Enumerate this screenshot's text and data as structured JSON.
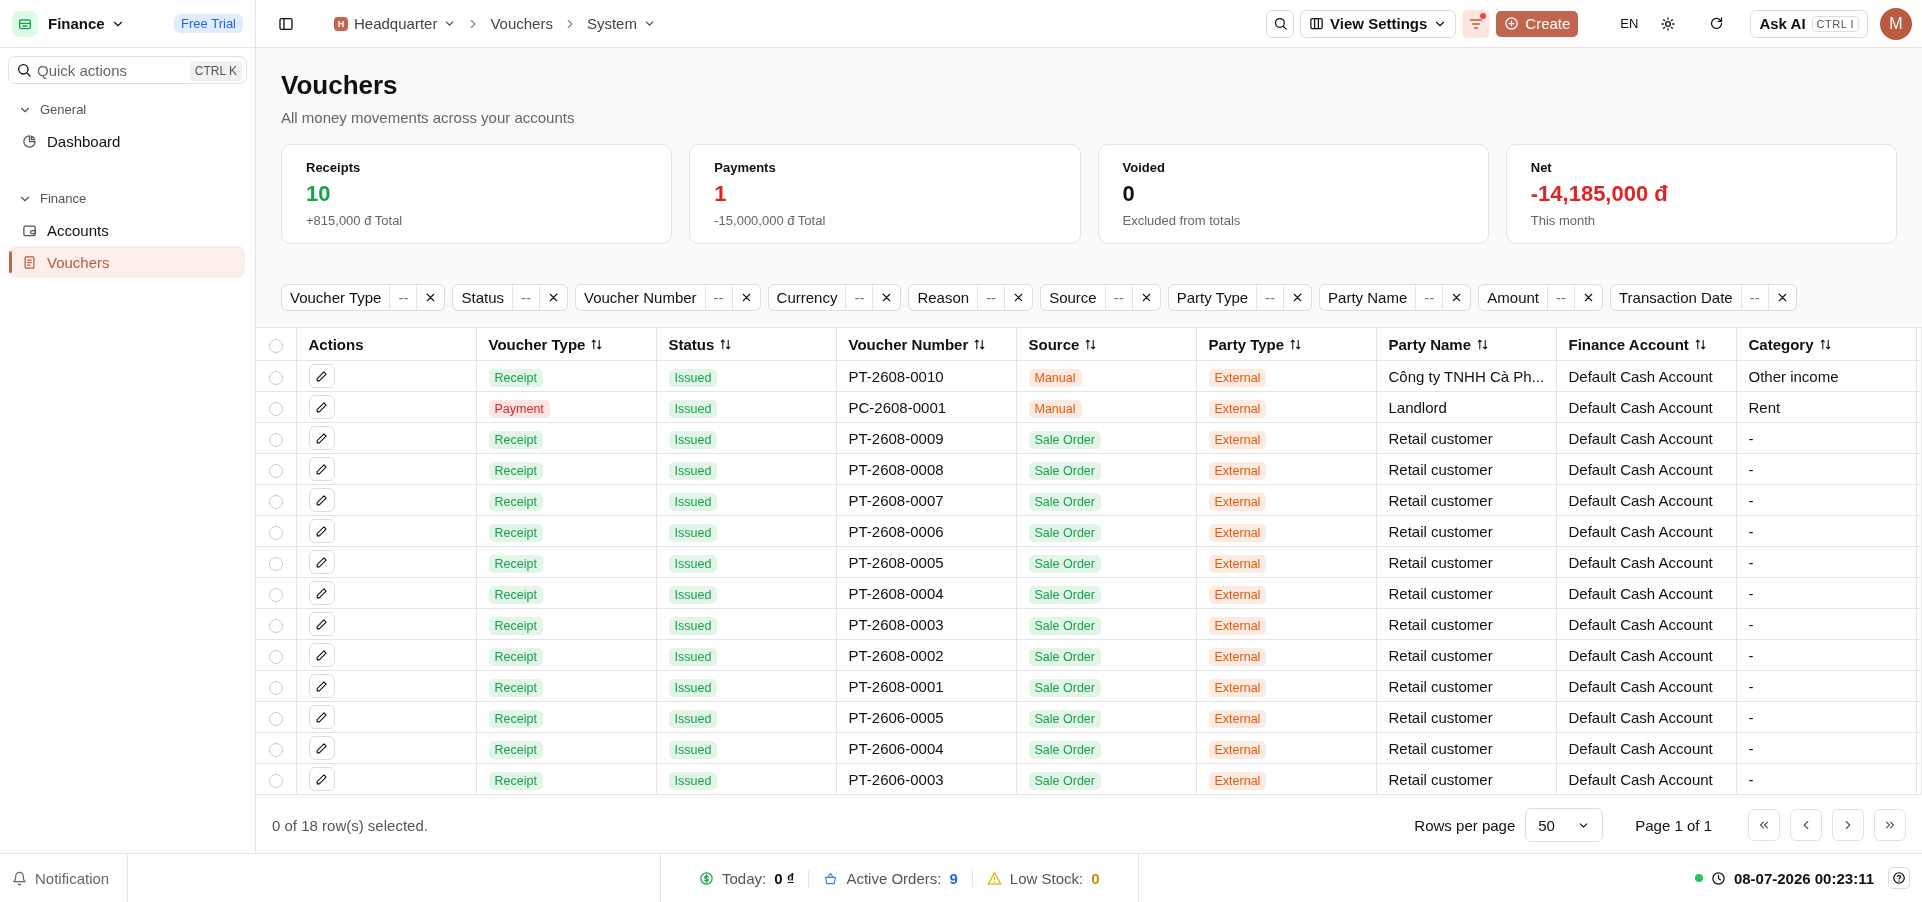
{
  "app": {
    "name": "Finance",
    "badge": "Free Trial"
  },
  "sidebar": {
    "search": {
      "placeholder": "Quick actions",
      "shortcut": "CTRL K"
    },
    "groups": [
      {
        "label": "General",
        "expanded": true,
        "items": [
          {
            "label": "Dashboard",
            "selected": false
          }
        ]
      },
      {
        "label": "Finance",
        "expanded": true,
        "items": [
          {
            "label": "Accounts",
            "selected": false
          },
          {
            "label": "Vouchers",
            "selected": true
          }
        ]
      }
    ]
  },
  "topbar": {
    "breadcrumb": [
      {
        "label": "Headquarter",
        "initial": "H",
        "dropdown": true
      },
      {
        "label": "Vouchers",
        "dropdown": false
      },
      {
        "label": "System",
        "dropdown": true
      }
    ],
    "view_settings": "View Settings",
    "filter_badge": true,
    "create": "Create",
    "language": "EN",
    "ask_ai": "Ask AI",
    "ask_ai_shortcut": "CTRL I",
    "avatar": "M"
  },
  "page": {
    "title": "Vouchers",
    "subtitle": "All money movements across your accounts"
  },
  "stats": [
    {
      "label": "Receipts",
      "value": "10",
      "color": "#16a34a",
      "note": "+815,000 đ Total"
    },
    {
      "label": "Payments",
      "value": "1",
      "color": "#dc2626",
      "note": "-15,000,000 đ Total"
    },
    {
      "label": "Voided",
      "value": "0",
      "color": "#111111",
      "note": "Excluded from totals"
    },
    {
      "label": "Net",
      "value": "-14,185,000 đ",
      "color": "#dc2626",
      "note": "This month"
    }
  ],
  "filters": [
    {
      "label": "Voucher Type",
      "value": "--"
    },
    {
      "label": "Status",
      "value": "--"
    },
    {
      "label": "Voucher Number",
      "value": "--"
    },
    {
      "label": "Currency",
      "value": "--"
    },
    {
      "label": "Reason",
      "value": "--"
    },
    {
      "label": "Source",
      "value": "--"
    },
    {
      "label": "Party Type",
      "value": "--"
    },
    {
      "label": "Party Name",
      "value": "--"
    },
    {
      "label": "Amount",
      "value": "--"
    },
    {
      "label": "Transaction Date",
      "value": "--"
    }
  ],
  "table": {
    "select_all_checked": false,
    "columns": [
      {
        "label": "Actions",
        "sortable": false
      },
      {
        "label": "Voucher Type",
        "sortable": true
      },
      {
        "label": "Status",
        "sortable": true
      },
      {
        "label": "Voucher Number",
        "sortable": true
      },
      {
        "label": "Source",
        "sortable": true
      },
      {
        "label": "Party Type",
        "sortable": true
      },
      {
        "label": "Party Name",
        "sortable": true
      },
      {
        "label": "Finance Account",
        "sortable": true
      },
      {
        "label": "Category",
        "sortable": true
      }
    ],
    "rows": [
      {
        "checked": false,
        "voucher_type": {
          "text": "Receipt",
          "color": "#16a34a"
        },
        "status": {
          "text": "Issued",
          "color": "#16a34a"
        },
        "voucher_number": "PT-2608-0010",
        "source": {
          "text": "Manual",
          "color": "#ea580c"
        },
        "party_type": {
          "text": "External",
          "color": "#ea580c"
        },
        "party_name": "Công ty TNHH Cà Ph...",
        "finance_account": "Default Cash Account",
        "category": "Other income"
      },
      {
        "checked": false,
        "voucher_type": {
          "text": "Payment",
          "color": "#dc2626"
        },
        "status": {
          "text": "Issued",
          "color": "#16a34a"
        },
        "voucher_number": "PC-2608-0001",
        "source": {
          "text": "Manual",
          "color": "#ea580c"
        },
        "party_type": {
          "text": "External",
          "color": "#ea580c"
        },
        "party_name": "Landlord",
        "finance_account": "Default Cash Account",
        "category": "Rent"
      },
      {
        "checked": false,
        "voucher_type": {
          "text": "Receipt",
          "color": "#16a34a"
        },
        "status": {
          "text": "Issued",
          "color": "#16a34a"
        },
        "voucher_number": "PT-2608-0009",
        "source": {
          "text": "Sale Order",
          "color": "#16a34a"
        },
        "party_type": {
          "text": "External",
          "color": "#ea580c"
        },
        "party_name": "Retail customer",
        "finance_account": "Default Cash Account",
        "category": "-"
      },
      {
        "checked": false,
        "voucher_type": {
          "text": "Receipt",
          "color": "#16a34a"
        },
        "status": {
          "text": "Issued",
          "color": "#16a34a"
        },
        "voucher_number": "PT-2608-0008",
        "source": {
          "text": "Sale Order",
          "color": "#16a34a"
        },
        "party_type": {
          "text": "External",
          "color": "#ea580c"
        },
        "party_name": "Retail customer",
        "finance_account": "Default Cash Account",
        "category": "-"
      },
      {
        "checked": false,
        "voucher_type": {
          "text": "Receipt",
          "color": "#16a34a"
        },
        "status": {
          "text": "Issued",
          "color": "#16a34a"
        },
        "voucher_number": "PT-2608-0007",
        "source": {
          "text": "Sale Order",
          "color": "#16a34a"
        },
        "party_type": {
          "text": "External",
          "color": "#ea580c"
        },
        "party_name": "Retail customer",
        "finance_account": "Default Cash Account",
        "category": "-"
      },
      {
        "checked": false,
        "voucher_type": {
          "text": "Receipt",
          "color": "#16a34a"
        },
        "status": {
          "text": "Issued",
          "color": "#16a34a"
        },
        "voucher_number": "PT-2608-0006",
        "source": {
          "text": "Sale Order",
          "color": "#16a34a"
        },
        "party_type": {
          "text": "External",
          "color": "#ea580c"
        },
        "party_name": "Retail customer",
        "finance_account": "Default Cash Account",
        "category": "-"
      },
      {
        "checked": false,
        "voucher_type": {
          "text": "Receipt",
          "color": "#16a34a"
        },
        "status": {
          "text": "Issued",
          "color": "#16a34a"
        },
        "voucher_number": "PT-2608-0005",
        "source": {
          "text": "Sale Order",
          "color": "#16a34a"
        },
        "party_type": {
          "text": "External",
          "color": "#ea580c"
        },
        "party_name": "Retail customer",
        "finance_account": "Default Cash Account",
        "category": "-"
      },
      {
        "checked": false,
        "voucher_type": {
          "text": "Receipt",
          "color": "#16a34a"
        },
        "status": {
          "text": "Issued",
          "color": "#16a34a"
        },
        "voucher_number": "PT-2608-0004",
        "source": {
          "text": "Sale Order",
          "color": "#16a34a"
        },
        "party_type": {
          "text": "External",
          "color": "#ea580c"
        },
        "party_name": "Retail customer",
        "finance_account": "Default Cash Account",
        "category": "-"
      },
      {
        "checked": false,
        "voucher_type": {
          "text": "Receipt",
          "color": "#16a34a"
        },
        "status": {
          "text": "Issued",
          "color": "#16a34a"
        },
        "voucher_number": "PT-2608-0003",
        "source": {
          "text": "Sale Order",
          "color": "#16a34a"
        },
        "party_type": {
          "text": "External",
          "color": "#ea580c"
        },
        "party_name": "Retail customer",
        "finance_account": "Default Cash Account",
        "category": "-"
      },
      {
        "checked": false,
        "voucher_type": {
          "text": "Receipt",
          "color": "#16a34a"
        },
        "status": {
          "text": "Issued",
          "color": "#16a34a"
        },
        "voucher_number": "PT-2608-0002",
        "source": {
          "text": "Sale Order",
          "color": "#16a34a"
        },
        "party_type": {
          "text": "External",
          "color": "#ea580c"
        },
        "party_name": "Retail customer",
        "finance_account": "Default Cash Account",
        "category": "-"
      },
      {
        "checked": false,
        "voucher_type": {
          "text": "Receipt",
          "color": "#16a34a"
        },
        "status": {
          "text": "Issued",
          "color": "#16a34a"
        },
        "voucher_number": "PT-2608-0001",
        "source": {
          "text": "Sale Order",
          "color": "#16a34a"
        },
        "party_type": {
          "text": "External",
          "color": "#ea580c"
        },
        "party_name": "Retail customer",
        "finance_account": "Default Cash Account",
        "category": "-"
      },
      {
        "checked": false,
        "voucher_type": {
          "text": "Receipt",
          "color": "#16a34a"
        },
        "status": {
          "text": "Issued",
          "color": "#16a34a"
        },
        "voucher_number": "PT-2606-0005",
        "source": {
          "text": "Sale Order",
          "color": "#16a34a"
        },
        "party_type": {
          "text": "External",
          "color": "#ea580c"
        },
        "party_name": "Retail customer",
        "finance_account": "Default Cash Account",
        "category": "-"
      },
      {
        "checked": false,
        "voucher_type": {
          "text": "Receipt",
          "color": "#16a34a"
        },
        "status": {
          "text": "Issued",
          "color": "#16a34a"
        },
        "voucher_number": "PT-2606-0004",
        "source": {
          "text": "Sale Order",
          "color": "#16a34a"
        },
        "party_type": {
          "text": "External",
          "color": "#ea580c"
        },
        "party_name": "Retail customer",
        "finance_account": "Default Cash Account",
        "category": "-"
      },
      {
        "checked": false,
        "voucher_type": {
          "text": "Receipt",
          "color": "#16a34a"
        },
        "status": {
          "text": "Issued",
          "color": "#16a34a"
        },
        "voucher_number": "PT-2606-0003",
        "source": {
          "text": "Sale Order",
          "color": "#16a34a"
        },
        "party_type": {
          "text": "External",
          "color": "#ea580c"
        },
        "party_name": "Retail customer",
        "finance_account": "Default Cash Account",
        "category": "-"
      }
    ]
  },
  "pagination": {
    "selection": "0 of 18 row(s) selected.",
    "rows_per_page_label": "Rows per page",
    "rows_per_page": "50",
    "page": "Page 1 of 1"
  },
  "status_bar": {
    "notification": "Notification",
    "today_label": "Today:",
    "today_value": "0 ₫",
    "orders_label": "Active Orders:",
    "orders_value": "9",
    "stock_label": "Low Stock:",
    "stock_value": "0",
    "online": true,
    "datetime": "08-07-2026 00:23:11"
  }
}
